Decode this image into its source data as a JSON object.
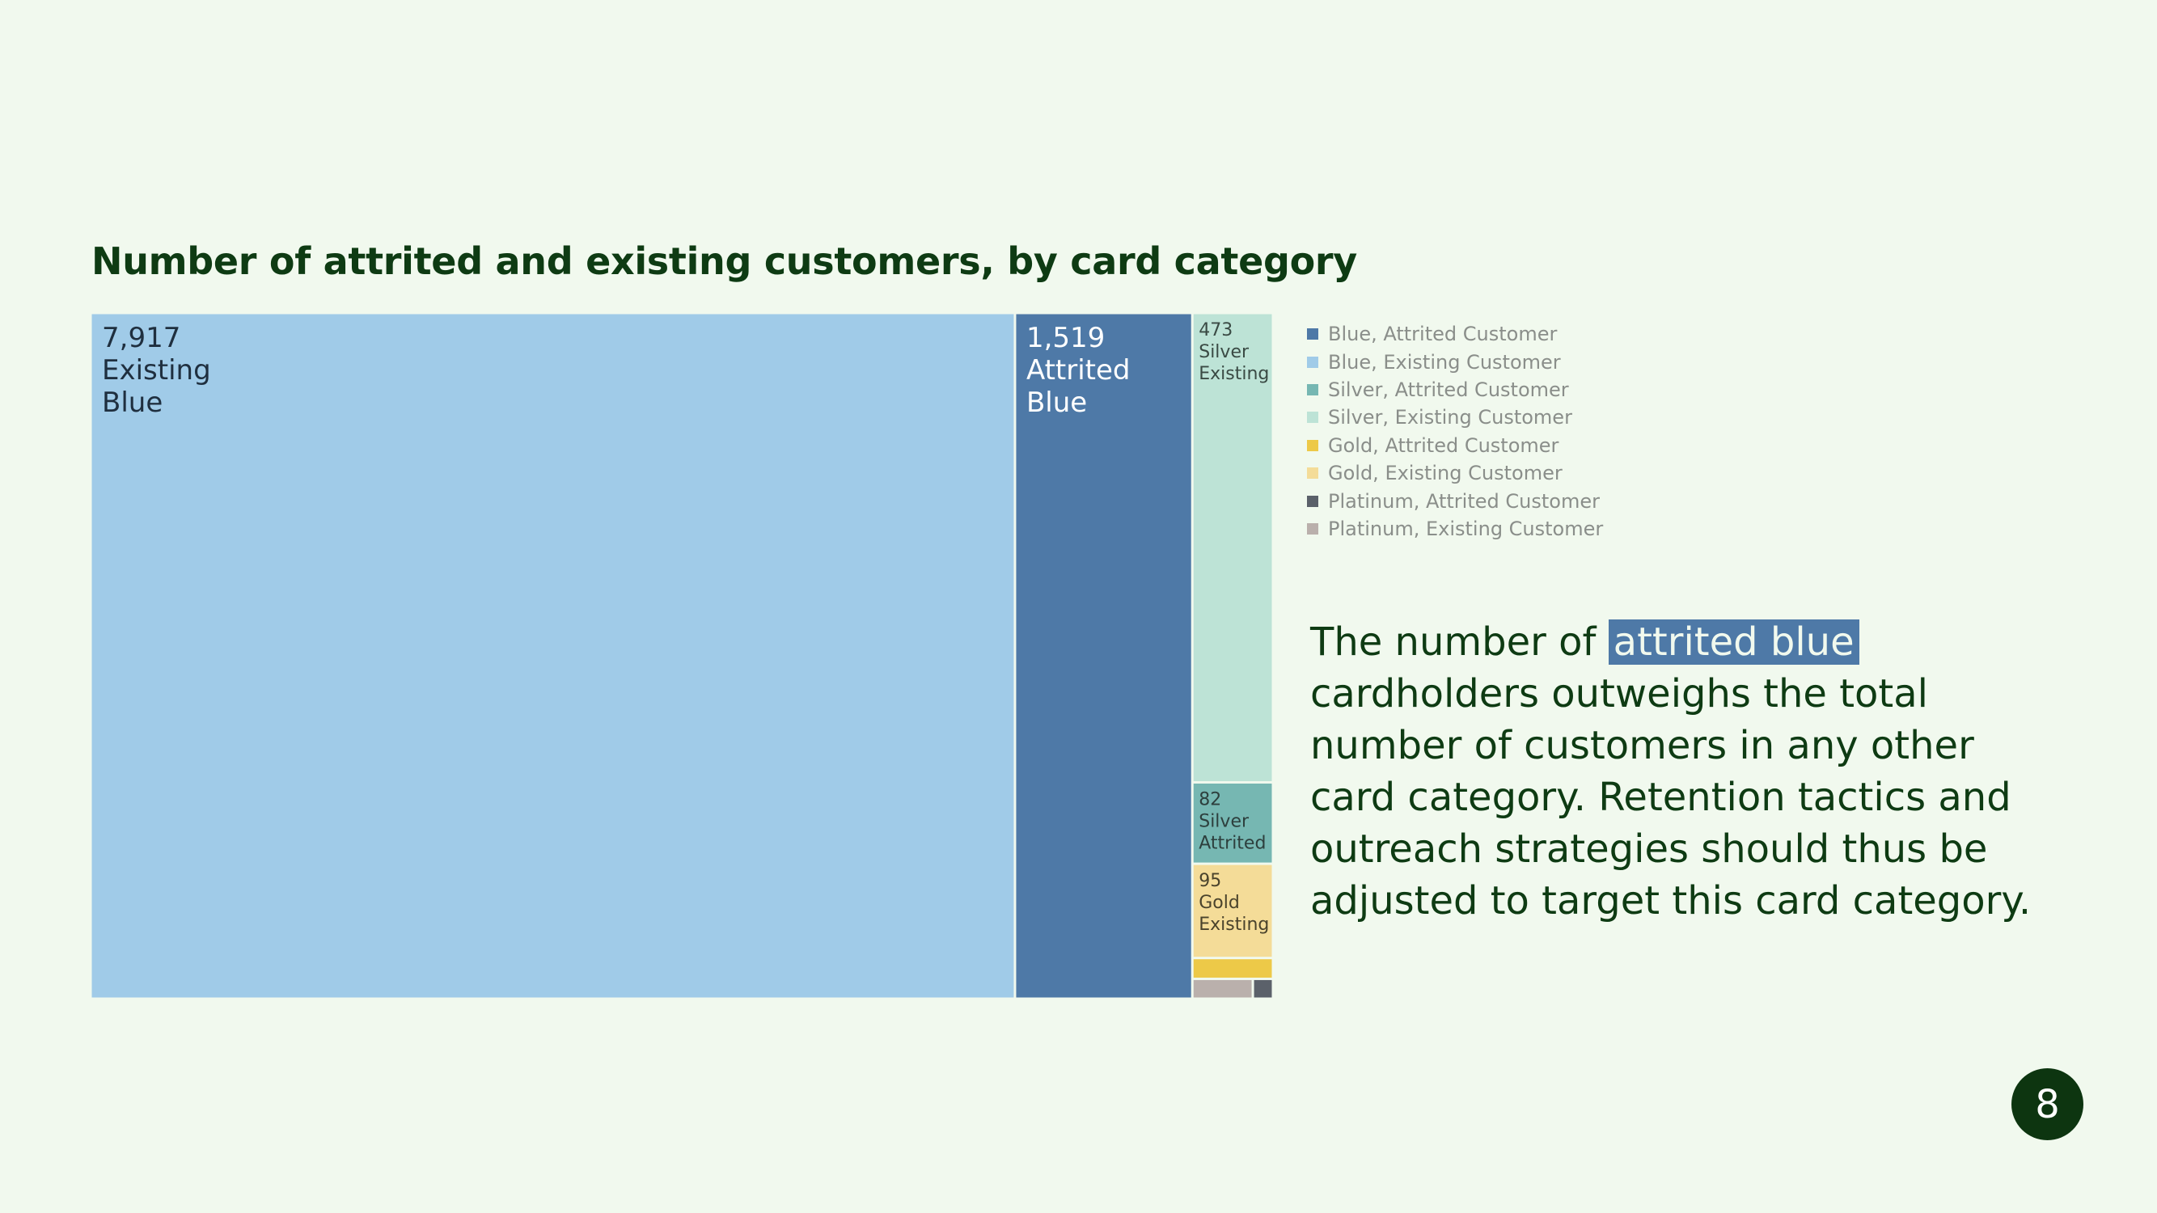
{
  "slide": {
    "title": "Number of attrited and existing customers, by card category",
    "page_number": "8"
  },
  "insight": {
    "before": "The number of ",
    "highlight": "attrited blue",
    "after": " cardholders outweighs the total number of customers in any other card category. Retention tactics and outreach strategies should thus be adjusted to target this card category."
  },
  "legend": [
    {
      "label": "Blue, Attrited Customer",
      "color": "#4e79a7"
    },
    {
      "label": "Blue, Existing Customer",
      "color": "#a0cbe8"
    },
    {
      "label": "Silver, Attrited Customer",
      "color": "#76b7b2"
    },
    {
      "label": "Silver, Existing Customer",
      "color": "#bde3d6"
    },
    {
      "label": "Gold, Attrited Customer",
      "color": "#edc948"
    },
    {
      "label": "Gold, Existing Customer",
      "color": "#f4dc98"
    },
    {
      "label": "Platinum, Attrited Customer",
      "color": "#5b616a"
    },
    {
      "label": "Platinum, Existing Customer",
      "color": "#bab0ac"
    }
  ],
  "chart_data": {
    "type": "treemap",
    "title": "Number of attrited and existing customers, by card category",
    "nodes": [
      {
        "card": "Blue",
        "status": "Existing",
        "value": 7917,
        "color": "#a0cbe8",
        "label": [
          "7,917",
          "Existing",
          "Blue"
        ],
        "text_color": "#1f2f3f"
      },
      {
        "card": "Blue",
        "status": "Attrited",
        "value": 1519,
        "color": "#4e79a7",
        "label": [
          "1,519",
          "Attrited",
          "Blue"
        ],
        "text_color": "#ffffff"
      },
      {
        "card": "Silver",
        "status": "Existing",
        "value": 473,
        "color": "#bde3d6",
        "label": [
          "473",
          "Silver",
          "Existing"
        ],
        "text_color": "#3a4a44"
      },
      {
        "card": "Silver",
        "status": "Attrited",
        "value": 82,
        "color": "#76b7b2",
        "label": [
          "82",
          "Silver",
          "Attrited"
        ],
        "text_color": "#2d3f3d"
      },
      {
        "card": "Gold",
        "status": "Existing",
        "value": 95,
        "color": "#f4dc98",
        "label": [
          "95",
          "Gold",
          "Existing"
        ],
        "text_color": "#4a432c"
      },
      {
        "card": "Gold",
        "status": "Attrited",
        "value": 21,
        "color": "#edc948",
        "label": []
      },
      {
        "card": "Platinum",
        "status": "Existing",
        "value": 15,
        "color": "#bab0ac",
        "label": []
      },
      {
        "card": "Platinum",
        "status": "Attrited",
        "value": 5,
        "color": "#5b616a",
        "label": []
      }
    ]
  }
}
